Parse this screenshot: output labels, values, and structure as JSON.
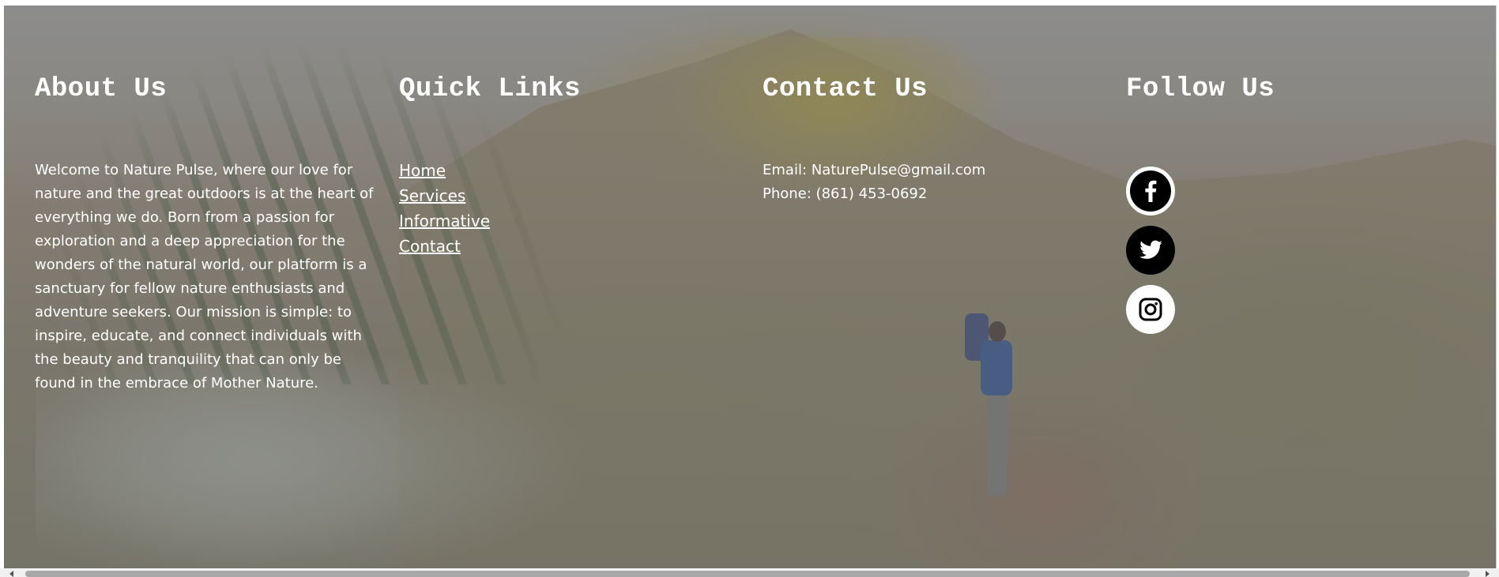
{
  "footer": {
    "about": {
      "heading": "About Us",
      "text": "Welcome to Nature Pulse, where our love for nature and the great outdoors is at the heart of everything we do. Born from a passion for exploration and a deep appreciation for the wonders of the natural world, our platform is a sanctuary for fellow nature enthusiasts and adventure seekers. Our mission is simple: to inspire, educate, and connect individuals with the beauty and tranquility that can only be found in the embrace of Mother Nature."
    },
    "quick_links": {
      "heading": "Quick Links",
      "items": [
        {
          "label": "Home"
        },
        {
          "label": "Services"
        },
        {
          "label": "Informative"
        },
        {
          "label": "Contact"
        }
      ]
    },
    "contact": {
      "heading": "Contact Us",
      "email": "Email: NaturePulse@gmail.com",
      "phone": "Phone: (861) 453-0692"
    },
    "follow": {
      "heading": "Follow Us",
      "icons": [
        "facebook-icon",
        "twitter-icon",
        "instagram-icon"
      ]
    }
  },
  "colors": {
    "text": "#ffffff",
    "overlay": "#5f5f5f",
    "icon_dark": "#000000",
    "icon_light": "#ffffff"
  }
}
